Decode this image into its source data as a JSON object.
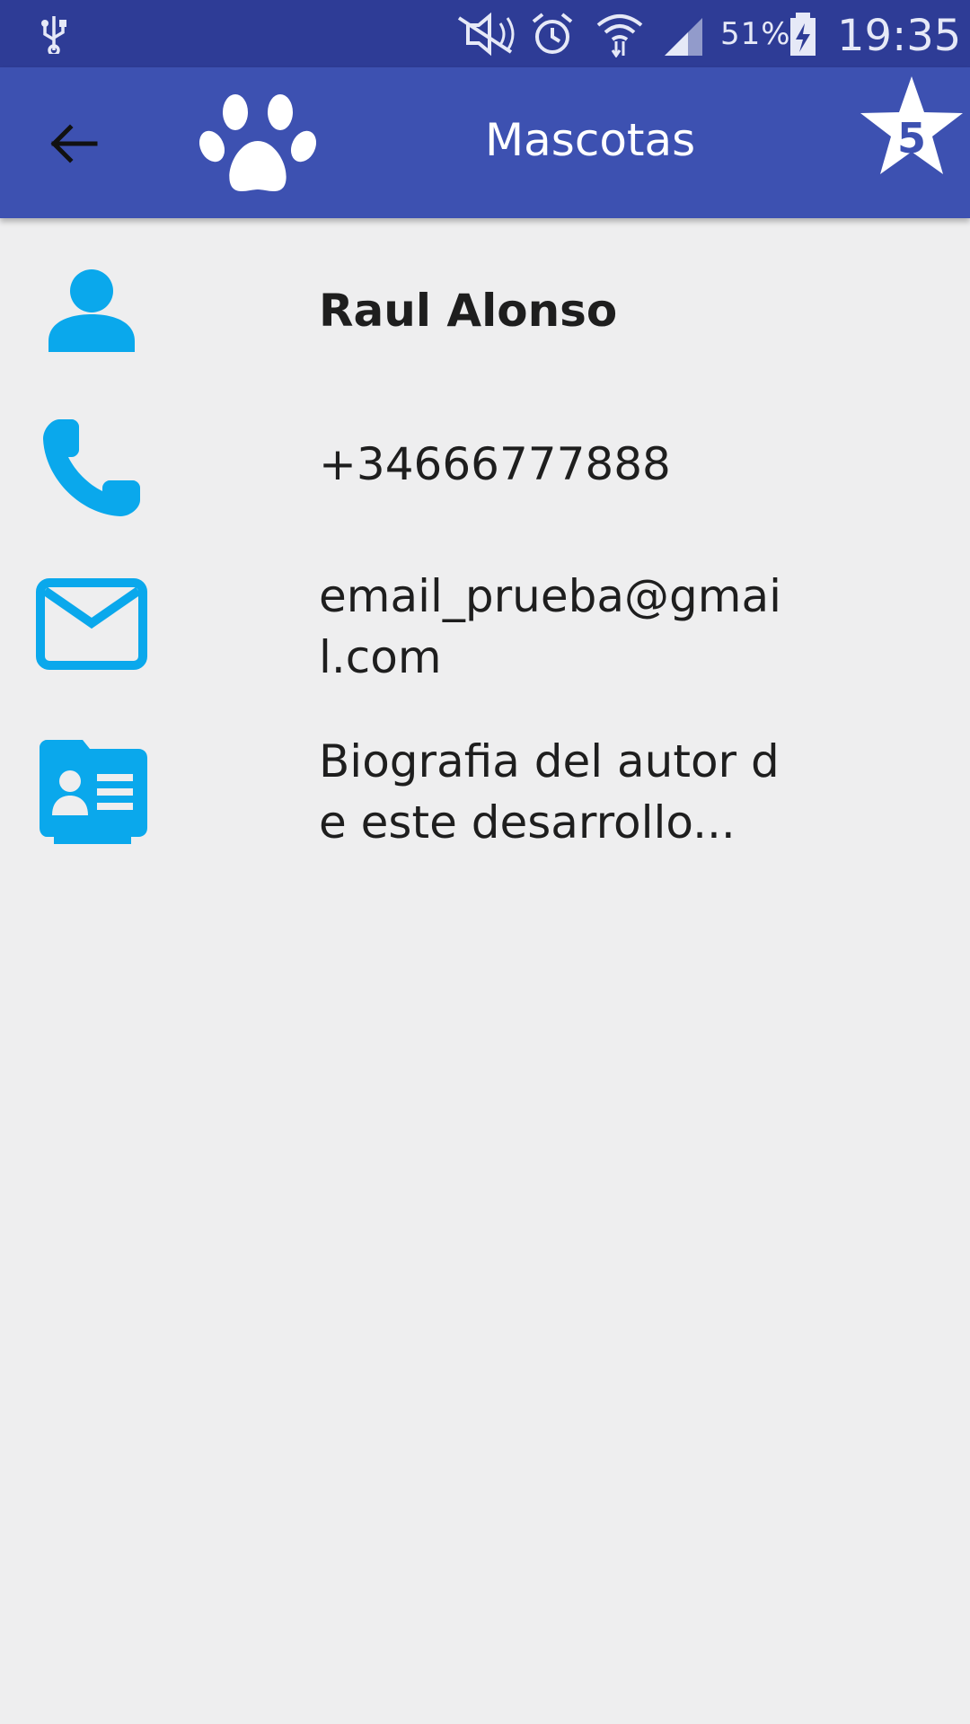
{
  "status_bar": {
    "battery": "51%",
    "time": "19:35",
    "icons": [
      "usb-icon",
      "mute-icon",
      "alarm-icon",
      "wifi-icon",
      "signal-icon",
      "battery-charging-icon"
    ]
  },
  "app_bar": {
    "title": "Mascotas",
    "star_count": "5",
    "colors": {
      "bar": "#3D51B1",
      "status": "#2E3C96"
    }
  },
  "contact": {
    "name": "Raul Alonso",
    "phone": "+34666777888",
    "email": "email_prueba@gmail.com",
    "bio": "Biografia del autor de este desarrollo..."
  },
  "accent": "#0AA8EC"
}
